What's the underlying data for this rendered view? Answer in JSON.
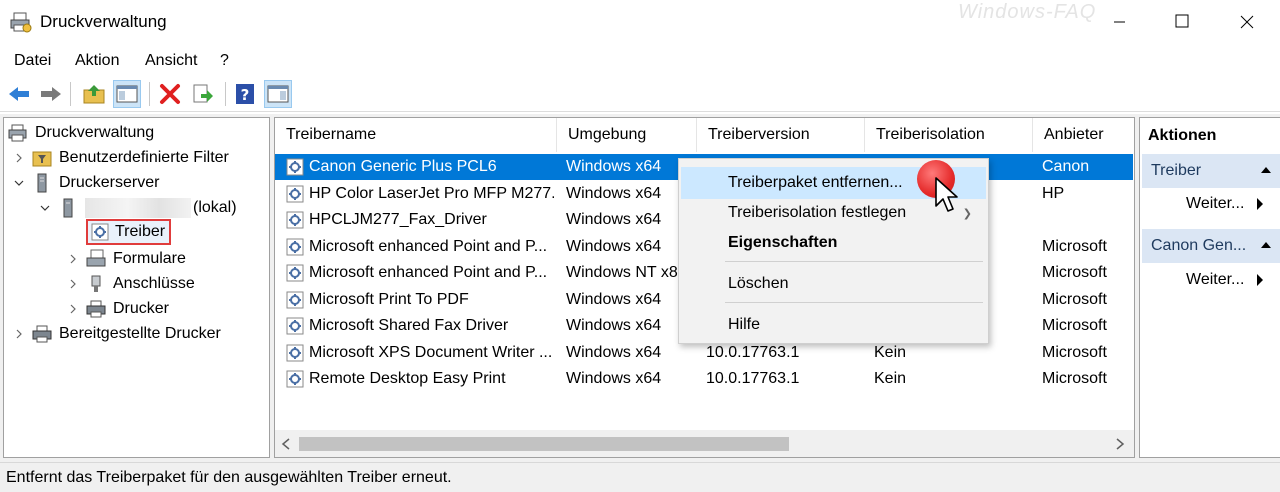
{
  "window": {
    "title": "Druckverwaltung",
    "watermark": "Windows-FAQ"
  },
  "menu": [
    "Datei",
    "Aktion",
    "Ansicht",
    "?"
  ],
  "toolbar": [
    "back-icon",
    "forward-icon",
    "up-folder-icon",
    "show-hide-tree-icon",
    "delete-icon",
    "export-icon",
    "help-icon",
    "show-hide-action-pane-icon"
  ],
  "tree": {
    "root": "Druckverwaltung",
    "items": [
      {
        "label": "Benutzerdefinierte Filter"
      },
      {
        "label": "Druckerserver"
      },
      {
        "label": "(lokal)"
      },
      {
        "label": "Treiber"
      },
      {
        "label": "Formulare"
      },
      {
        "label": "Anschlüsse"
      },
      {
        "label": "Drucker"
      },
      {
        "label": "Bereitgestellte Drucker"
      }
    ]
  },
  "list": {
    "columns": [
      "Treibername",
      "Umgebung",
      "Treiberversion",
      "Treiberisolation",
      "Anbieter"
    ],
    "rows": [
      {
        "name": "Canon Generic Plus PCL6",
        "env": "Windows x64",
        "version": "",
        "isolation": "",
        "vendor": "Canon"
      },
      {
        "name": "HP Color LaserJet Pro MFP M277...",
        "env": "Windows x64",
        "version": "",
        "isolation": "",
        "vendor": "HP"
      },
      {
        "name": "HPCLJM277_Fax_Driver",
        "env": "Windows x64",
        "version": "",
        "isolation": "",
        "vendor": ""
      },
      {
        "name": "Microsoft enhanced Point and P...",
        "env": "Windows x64",
        "version": "",
        "isolation": "",
        "vendor": "Microsoft"
      },
      {
        "name": "Microsoft enhanced Point and P...",
        "env": "Windows NT x8",
        "version": "",
        "isolation": "",
        "vendor": "Microsoft"
      },
      {
        "name": "Microsoft Print To PDF",
        "env": "Windows x64",
        "version": "",
        "isolation": "",
        "vendor": "Microsoft"
      },
      {
        "name": "Microsoft Shared Fax Driver",
        "env": "Windows x64",
        "version": "",
        "isolation": "",
        "vendor": "Microsoft"
      },
      {
        "name": "Microsoft XPS Document Writer ...",
        "env": "Windows x64",
        "version": "10.0.17763.1",
        "isolation": "Kein",
        "vendor": "Microsoft"
      },
      {
        "name": "Remote Desktop Easy Print",
        "env": "Windows x64",
        "version": "10.0.17763.1",
        "isolation": "Kein",
        "vendor": "Microsoft"
      }
    ]
  },
  "actions": {
    "title": "Aktionen",
    "sections": [
      {
        "label": "Treiber",
        "item": "Weiter..."
      },
      {
        "label": "Canon Gen...",
        "item": "Weiter..."
      }
    ]
  },
  "context_menu": {
    "items": [
      "Treiberpaket entfernen...",
      "Treiberisolation festlegen",
      "Eigenschaften",
      "Löschen",
      "Hilfe"
    ]
  },
  "status": "Entfernt das Treiberpaket für den ausgewählten Treiber erneut.",
  "colors": {
    "selection": "#0078d7",
    "highlight_box": "#e03c3c",
    "marker": "#e52b2b"
  }
}
